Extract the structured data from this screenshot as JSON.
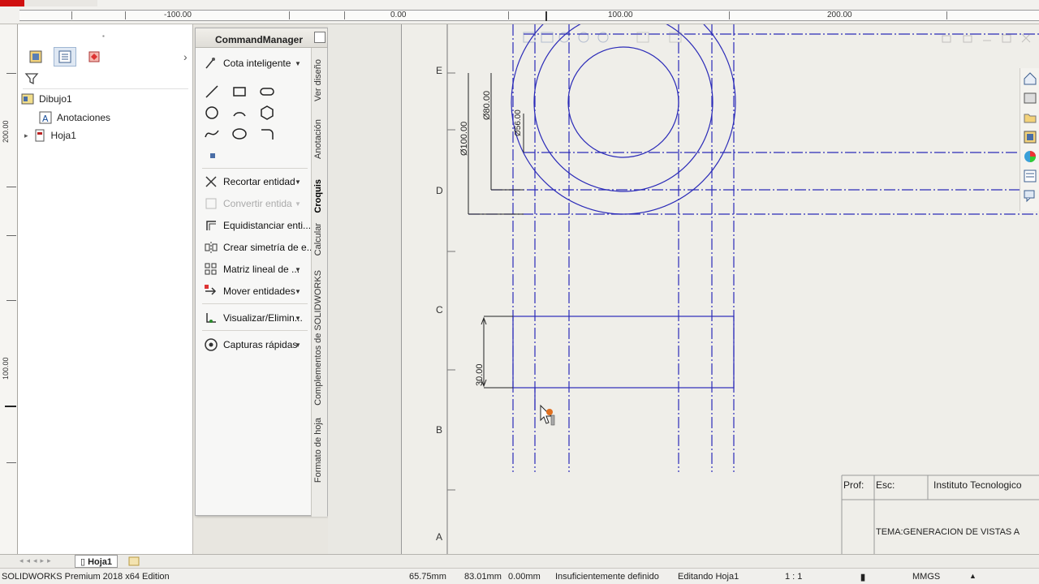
{
  "top_ruler": {
    "ticks": [
      "-100.00",
      "0.00",
      "100.00",
      "200.00"
    ]
  },
  "left_ruler": {
    "ticks": [
      "200.00",
      "100.00"
    ]
  },
  "feature_tree": {
    "root": "Dibujo1",
    "items": [
      {
        "label": "Anotaciones"
      },
      {
        "label": "Hoja1"
      }
    ]
  },
  "command_manager": {
    "title": "CommandManager",
    "items": [
      {
        "label": "Cota inteligente"
      },
      {
        "label": "Recortar entidad"
      },
      {
        "label": "Convertir entida"
      },
      {
        "label": "Equidistanciar enti..."
      },
      {
        "label": "Crear simetría de e..."
      },
      {
        "label": "Matriz lineal de ..."
      },
      {
        "label": "Mover entidades"
      },
      {
        "label": "Visualizar/Elimin..."
      },
      {
        "label": "Capturas rápidas"
      }
    ],
    "vertical_tabs": [
      {
        "label": "Ver diseño"
      },
      {
        "label": "Anotación"
      },
      {
        "label": "Croquis"
      },
      {
        "label": "Calcular"
      },
      {
        "label": "Complementos de SOLIDWORKS"
      },
      {
        "label": "Formato de hoja"
      }
    ]
  },
  "drawing": {
    "zone_letters": [
      "E",
      "D",
      "C",
      "B",
      "A"
    ],
    "dimensions": [
      "Ø100.00",
      "Ø80.00",
      "Ø56.00",
      "30.00"
    ]
  },
  "title_block": {
    "prof_label": "Prof:",
    "esc_label": "Esc:",
    "institution": "Instituto Tecnologico",
    "tema": "TEMA:GENERACION DE VISTAS A"
  },
  "sheet_tabs": [
    {
      "label": "Hoja1"
    }
  ],
  "status_bar": {
    "app": "SOLIDWORKS Premium 2018 x64 Edition",
    "x": "65.75mm",
    "y": "83.01mm",
    "z": "0.00mm",
    "state": "Insuficientemente definido",
    "mode": "Editando Hoja1",
    "scale": "1 : 1",
    "units": "MMGS"
  },
  "colors": {
    "drawing_line": "#2b2bb8",
    "accent_red": "#d01010"
  }
}
